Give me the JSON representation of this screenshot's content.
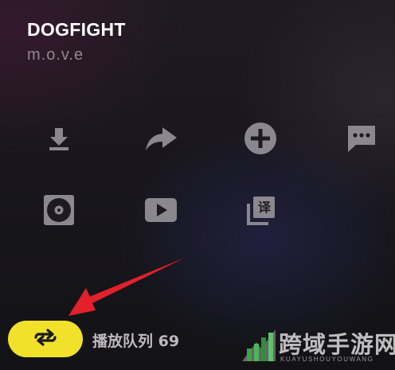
{
  "song": {
    "title": "DOGFIGHT",
    "artist": "m.o.v.e"
  },
  "actions": {
    "row1": [
      {
        "icon": "download-icon"
      },
      {
        "icon": "share-icon"
      },
      {
        "icon": "add-circle-icon"
      },
      {
        "icon": "comment-icon"
      }
    ],
    "row2": [
      {
        "icon": "vinyl-disc-icon"
      },
      {
        "icon": "video-play-icon"
      },
      {
        "icon": "translate-lyrics-icon",
        "glyph": "译"
      }
    ]
  },
  "playback": {
    "mode_icon": "loop-repeat-icon",
    "queue_label": "播放队列 69"
  },
  "colors": {
    "accent": "#f2e12b",
    "icon": "#8a888e",
    "arrow": "#e2212a"
  },
  "watermark": {
    "text": "跨域手游网",
    "subtext": "KUAYUSHOUYOUWANG"
  }
}
